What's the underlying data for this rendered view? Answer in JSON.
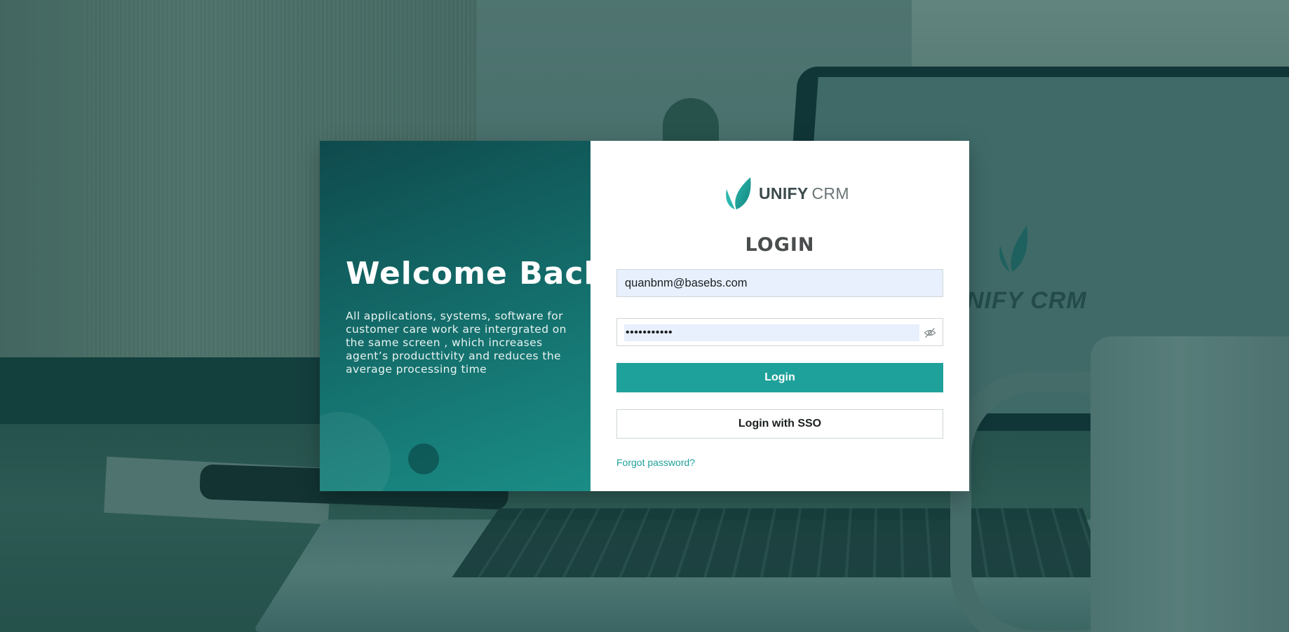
{
  "background": {
    "ghost_logo_text": "NIFY CRM"
  },
  "welcome": {
    "title": "Welcome Back",
    "description": "All applications, systems, software for customer care work are intergrated on the same screen , which increases agent’s producttivity and reduces the average processing time"
  },
  "brand": {
    "name_strong": "UNIFY",
    "name_light": "CRM",
    "logo_icon": "leaf-logo-icon"
  },
  "login": {
    "heading": "LOGIN",
    "email_value": "quanbnm@basebs.com",
    "password_value": "•••••••••••",
    "password_toggle_icon": "eye-off-icon",
    "login_button": "Login",
    "sso_button": "Login with SSO",
    "forgot_link": "Forgot password?"
  },
  "colors": {
    "accent": "#1fa19b",
    "panel_dark": "#0f4a4d",
    "autofill_bg": "#e8f0fe",
    "heading_text": "#4a4d4e"
  }
}
